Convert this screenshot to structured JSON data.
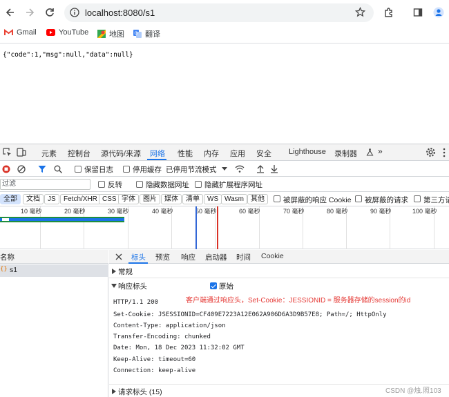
{
  "browser": {
    "url": "localhost:8080/s1",
    "bookmarks": [
      {
        "label": "Gmail",
        "icon": "gmail-icon"
      },
      {
        "label": "YouTube",
        "icon": "youtube-icon"
      },
      {
        "label": "地图",
        "icon": "maps-icon"
      },
      {
        "label": "翻译",
        "icon": "translate-icon"
      }
    ]
  },
  "page": {
    "body_text": "{\"code\":1,\"msg\":null,\"data\":null}"
  },
  "devtools": {
    "panel_tabs": [
      "元素",
      "控制台",
      "源代码/来源",
      "网络",
      "性能",
      "内存",
      "应用",
      "安全",
      "Lighthouse",
      "录制器"
    ],
    "active_panel": "网络",
    "more_tabs_symbol": "»",
    "toolbar": {
      "preserve_log": "保留日志",
      "disable_cache": "停用缓存",
      "throttling": "已停用节流模式"
    },
    "filter": {
      "placeholder": "过滤",
      "invert": "反转",
      "hide_data_urls": "隐藏数据网址",
      "hide_extension_urls": "隐藏扩展程序网址"
    },
    "type_filters": [
      "全部",
      "文档",
      "JS",
      "Fetch/XHR",
      "CSS",
      "字体",
      "图片",
      "媒体",
      "清单",
      "WS",
      "Wasm",
      "其他"
    ],
    "type_options": {
      "blocked_cookies": "被屏蔽的响应 Cookie",
      "blocked_requests": "被屏蔽的请求",
      "third_party": "第三方请"
    },
    "timeline_ticks": [
      "10 毫秒",
      "20 毫秒",
      "30 毫秒",
      "40 毫秒",
      "50 毫秒",
      "60 毫秒",
      "70 毫秒",
      "80 毫秒",
      "90 毫秒",
      "100 毫秒"
    ],
    "requests": {
      "header": "名称",
      "rows": [
        {
          "name": "s1",
          "icon": "fetch-icon"
        }
      ]
    },
    "detail": {
      "tabs": [
        "标头",
        "预览",
        "响应",
        "启动器",
        "时间",
        "Cookie"
      ],
      "active_tab": "标头",
      "general": "常规",
      "response_headers": "响应标头",
      "raw": "原始",
      "header_lines": [
        "HTTP/1.1 200",
        "Set-Cookie: JSESSIONID=CF409E7223A12E062A906D6A3D9B57E8; Path=/; HttpOnly",
        "Content-Type: application/json",
        "Transfer-Encoding: chunked",
        "Date: Mon, 18 Dec 2023 11:32:02 GMT",
        "Keep-Alive: timeout=60",
        "Connection: keep-alive"
      ],
      "annotation": "客户端通过响应头，Set-Cookie：JESSIONID = 服务器存储的session的id",
      "request_headers": "请求标头 (15)"
    }
  },
  "watermark": "CSDN @烛.照103",
  "colors": {
    "accent": "#1a73e8",
    "annotation": "#e53935",
    "record": "#d93025"
  }
}
